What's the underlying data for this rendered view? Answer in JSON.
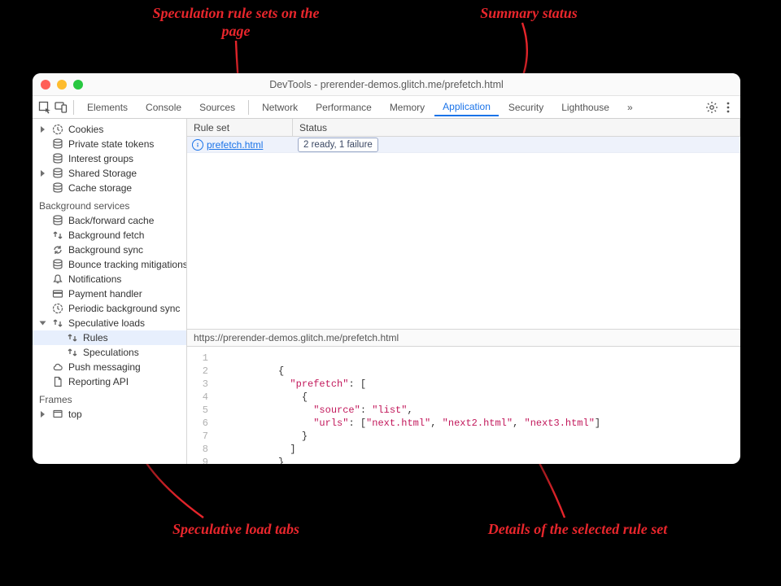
{
  "window": {
    "title": "DevTools - prerender-demos.glitch.me/prefetch.html"
  },
  "tabs": {
    "items": [
      {
        "label": "Elements"
      },
      {
        "label": "Console"
      },
      {
        "label": "Sources"
      },
      {
        "label": "Network"
      },
      {
        "label": "Performance"
      },
      {
        "label": "Memory"
      },
      {
        "label": "Application",
        "selected": true
      },
      {
        "label": "Security"
      },
      {
        "label": "Lighthouse"
      }
    ],
    "overflow_glyph": "»"
  },
  "sidebar": {
    "storage_items": [
      {
        "name": "sidebar-item-cookies",
        "icon": "clock-icon",
        "caret": true,
        "label": "Cookies"
      },
      {
        "name": "sidebar-item-private-state-tokens",
        "icon": "db-icon",
        "label": "Private state tokens"
      },
      {
        "name": "sidebar-item-interest-groups",
        "icon": "db-icon",
        "label": "Interest groups"
      },
      {
        "name": "sidebar-item-shared-storage",
        "icon": "db-icon",
        "caret": true,
        "label": "Shared Storage"
      },
      {
        "name": "sidebar-item-cache-storage",
        "icon": "db-icon",
        "label": "Cache storage"
      }
    ],
    "bg_heading": "Background services",
    "bg_items": [
      {
        "name": "sidebar-item-back-forward-cache",
        "icon": "db-icon",
        "label": "Back/forward cache"
      },
      {
        "name": "sidebar-item-background-fetch",
        "icon": "arrows-icon",
        "label": "Background fetch"
      },
      {
        "name": "sidebar-item-background-sync",
        "icon": "sync-icon",
        "label": "Background sync"
      },
      {
        "name": "sidebar-item-bounce-tracking",
        "icon": "db-icon",
        "label": "Bounce tracking mitigations"
      },
      {
        "name": "sidebar-item-notifications",
        "icon": "bell-icon",
        "label": "Notifications"
      },
      {
        "name": "sidebar-item-payment-handler",
        "icon": "card-icon",
        "label": "Payment handler"
      },
      {
        "name": "sidebar-item-periodic-bg-sync",
        "icon": "clock-icon",
        "label": "Periodic background sync"
      },
      {
        "name": "sidebar-item-speculative-loads",
        "icon": "arrows-icon",
        "caret": true,
        "caret_down": true,
        "label": "Speculative loads"
      },
      {
        "name": "sidebar-item-rules",
        "icon": "arrows-icon",
        "sub": true,
        "selected": true,
        "label": "Rules"
      },
      {
        "name": "sidebar-item-speculations",
        "icon": "arrows-icon",
        "sub": true,
        "label": "Speculations"
      },
      {
        "name": "sidebar-item-push-messaging",
        "icon": "cloud-icon",
        "label": "Push messaging"
      },
      {
        "name": "sidebar-item-reporting-api",
        "icon": "doc-icon",
        "label": "Reporting API"
      }
    ],
    "frames_heading": "Frames",
    "frames_items": [
      {
        "name": "sidebar-item-frame-top",
        "icon": "frame-icon",
        "caret": true,
        "label": "top"
      }
    ]
  },
  "table": {
    "col_ruleset": "Rule set",
    "col_status": "Status",
    "rows": [
      {
        "ruleset_label": "prefetch.html",
        "status_label": "2 ready, 1 failure"
      }
    ]
  },
  "details": {
    "url": "https://prerender-demos.glitch.me/prefetch.html"
  },
  "code": {
    "line_count": 9,
    "tokens": {
      "prefetch": "\"prefetch\"",
      "source_k": "\"source\"",
      "source_v": "\"list\"",
      "urls_k": "\"urls\"",
      "url1": "\"next.html\"",
      "url2": "\"next2.html\"",
      "url3": "\"next3.html\""
    }
  },
  "annotations": {
    "rulesets": "Speculation rule sets\non the page",
    "summary": "Summary status",
    "tabs": "Speculative load tabs",
    "details": "Details of the selected rule set"
  }
}
